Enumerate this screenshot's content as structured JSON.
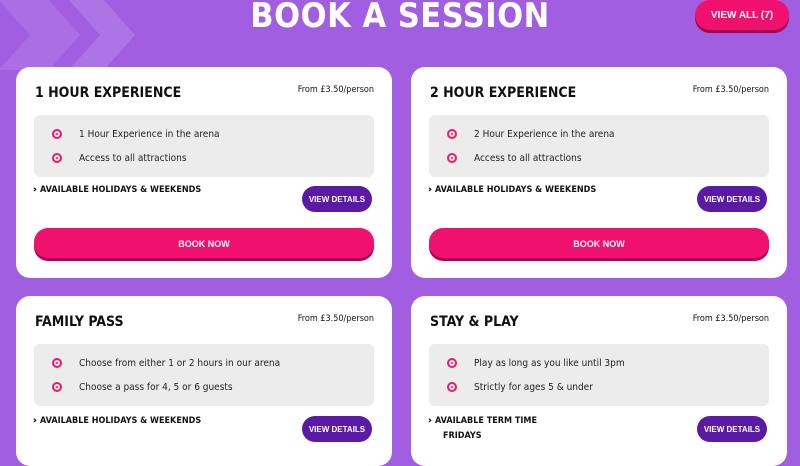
{
  "header": {
    "title": "BOOK A SESSION",
    "view_all_label": "VIEW ALL (7)"
  },
  "colors": {
    "background": "#a25ee0",
    "accent_pink": "#f0106e",
    "button_purple": "#5a1aa6"
  },
  "icons": {
    "bullet": "target-bullet-icon",
    "availability": "double-chevron-icon"
  },
  "cards": [
    {
      "title": "1 HOUR EXPERIENCE",
      "price": "From £3.50/person",
      "features": [
        "1 Hour Experience in the arena",
        "Access to all attractions"
      ],
      "availability": [
        "AVAILABLE HOLIDAYS & WEEKENDS"
      ],
      "details_label": "VIEW DETAILS",
      "book_label": "BOOK NOW"
    },
    {
      "title": "2 HOUR EXPERIENCE",
      "price": "From £3.50/person",
      "features": [
        "2 Hour Experience in the arena",
        "Access to all attractions"
      ],
      "availability": [
        "AVAILABLE HOLIDAYS & WEEKENDS"
      ],
      "details_label": "VIEW DETAILS",
      "book_label": "BOOK NOW"
    },
    {
      "title": "FAMILY PASS",
      "price": "From £3.50/person",
      "features": [
        "Choose from either 1 or 2 hours in our arena",
        "Choose a pass for 4, 5 or 6 guests"
      ],
      "availability": [
        "AVAILABLE HOLIDAYS & WEEKENDS"
      ],
      "details_label": "VIEW DETAILS"
    },
    {
      "title": "STAY & PLAY",
      "price": "From £3.50/person",
      "features": [
        "Play as long as you like until 3pm",
        "Strictly for ages 5 & under"
      ],
      "availability": [
        "AVAILABLE TERM TIME",
        "FRIDAYS"
      ],
      "details_label": "VIEW DETAILS"
    }
  ]
}
